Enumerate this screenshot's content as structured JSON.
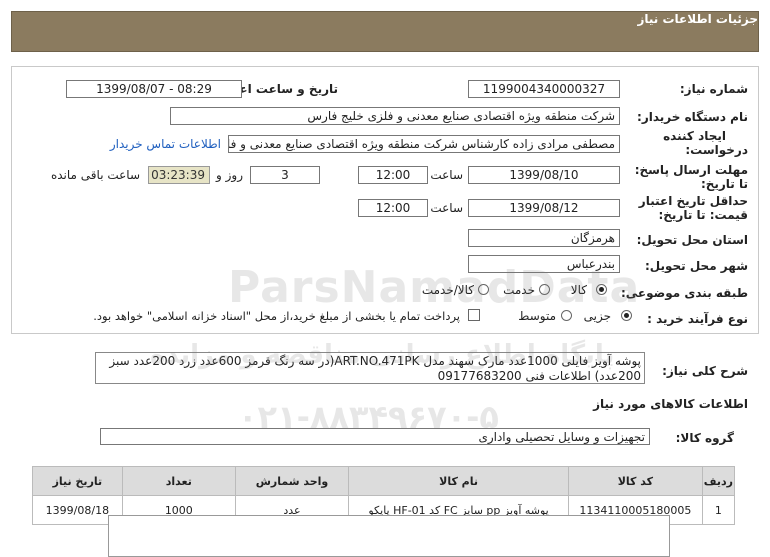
{
  "header": {
    "title": "جزئیات اطلاعات نیاز"
  },
  "form": {
    "need_number_label": "شماره نیاز:",
    "need_number": "1199004340000327",
    "announce_label": "تاریخ و ساعت اعلان عمومی:",
    "announce_value": "1399/08/07 - 08:29",
    "buyer_label": "نام دستگاه خریدار:",
    "buyer_value": "شرکت منطقه ویژه اقتصادی صنایع معدنی و فلزی خلیج فارس",
    "creator_label_line1": "ایجاد کننده",
    "creator_label_line2": "درخواست:",
    "creator_value": "مصطفی مرادی زاده کارشناس شرکت منطقه ویژه اقتصادی صنایع معدنی و فلزی",
    "contact_link": "اطلاعات تماس خریدار",
    "deadline_label_line1": "مهلت ارسال پاسخ:",
    "deadline_label_line2": "تا تاریخ:",
    "deadline_date": "1399/08/10",
    "time_label": "ساعت",
    "deadline_time": "12:00",
    "days_value": "3",
    "days_label": "روز و",
    "remaining_time": "03:23:39",
    "remaining_label": "ساعت باقی مانده",
    "validity_label_line1": "حداقل تاریخ اعتبار",
    "validity_label_line2": "قیمت: تا تاریخ:",
    "validity_date": "1399/08/12",
    "validity_time_label": "ساعت",
    "validity_time": "12:00",
    "province_label": "استان محل تحویل:",
    "province_value": "هرمزگان",
    "city_label": "شهر محل تحویل:",
    "city_value": "بندرعباس",
    "category_label": "طبقه بندی موضوعی:",
    "category_options": [
      "کالا",
      "خدمت",
      "کالا/خدمت"
    ],
    "category_selected": "کالا",
    "process_label": "نوع فرآیند خرید :",
    "process_options": [
      "جزیی",
      "متوسط"
    ],
    "process_selected": "جزیی",
    "payment_note": "پرداخت تمام یا بخشی از مبلغ خرید،از محل \"اسناد خزانه اسلامی\" خواهد بود."
  },
  "description": {
    "label": "شرح کلی نیاز:",
    "text": "پوشه آویز فایلی 1000عدد مارک سهند مدل ART.NO.471PK(در سه رنگ قرمز 600عدد    زرد 200عدد  سبز 200عدد) اطلاعات فنی 09177683200"
  },
  "goods": {
    "section_title": "اطلاعات کالاهای مورد نیاز",
    "group_label": "گروه کالا:",
    "group_value": "تجهیزات و وسایل تحصیلی واداری",
    "columns": [
      "ردیف",
      "کد کالا",
      "نام کالا",
      "واحد شمارش",
      "تعداد",
      "تاریخ نیاز"
    ],
    "rows": [
      [
        "1",
        "1134110005180005",
        "پوشه آویز pp سایز FC کد HF-01 پاپکو",
        "عدد",
        "1000",
        "1399/08/18"
      ]
    ]
  },
  "watermark": {
    "line1": "ParsNamadData",
    "line2": "پایگاه اطلاع رسانی مناقصه و مزایده",
    "line3": "۰۲۱-۸۸۳۴۹۶۷۰-۵"
  }
}
